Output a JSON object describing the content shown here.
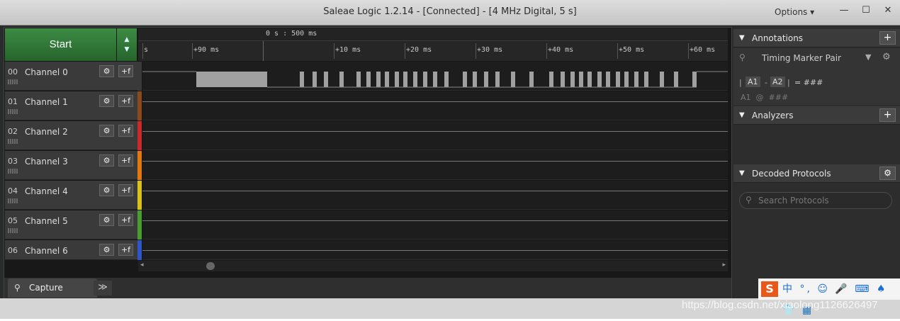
{
  "window": {
    "title": "Saleae Logic 1.2.14 - [Connected] - [4 MHz Digital, 5 s]",
    "options_label": "Options ▾",
    "minimize": "—",
    "maximize": "☐",
    "close": "✕"
  },
  "toolbar": {
    "start_label": "Start",
    "arrows": "▲\n▼"
  },
  "timeline": {
    "center_time": "0 s : 500 ms",
    "labels": [
      "s",
      "+90 ms",
      "+10 ms",
      "+20 ms",
      "+30 ms",
      "+40 ms",
      "+50 ms",
      "+60 ms"
    ]
  },
  "channels": [
    {
      "num": "00",
      "name": "Channel 0",
      "color": "#3a3a3a"
    },
    {
      "num": "01",
      "name": "Channel 1",
      "color": "#8b4a1c"
    },
    {
      "num": "02",
      "name": "Channel 2",
      "color": "#c92a2a"
    },
    {
      "num": "03",
      "name": "Channel 3",
      "color": "#e07a10"
    },
    {
      "num": "04",
      "name": "Channel 4",
      "color": "#d8c21a"
    },
    {
      "num": "05",
      "name": "Channel 5",
      "color": "#4a9e2f"
    },
    {
      "num": "06",
      "name": "Channel 6",
      "color": "#2e56c7"
    }
  ],
  "channel_buttons": {
    "gear": "⚙",
    "trigger": "+f"
  },
  "capture": {
    "tab_label": "Capture",
    "more": "≫"
  },
  "annotations": {
    "title": "Annotations",
    "add": "+",
    "marker_name": "Timing Marker Pair",
    "marker_icon": "pin-icon",
    "a1": "A1",
    "a2": "A2",
    "formula": "= ###",
    "row2": "A1  @  ###"
  },
  "analyzers": {
    "title": "Analyzers",
    "add": "+"
  },
  "decoded": {
    "title": "Decoded Protocols",
    "search_placeholder": "Search Protocols"
  },
  "ime": {
    "text": "中 °, ☺ 🎤 ⌨ ♠ 👕 ▦"
  },
  "watermark": "https://blog.csdn.net/xiaolong1126626497",
  "colors": {
    "accent": "#2f7a37",
    "background": "#181818"
  }
}
